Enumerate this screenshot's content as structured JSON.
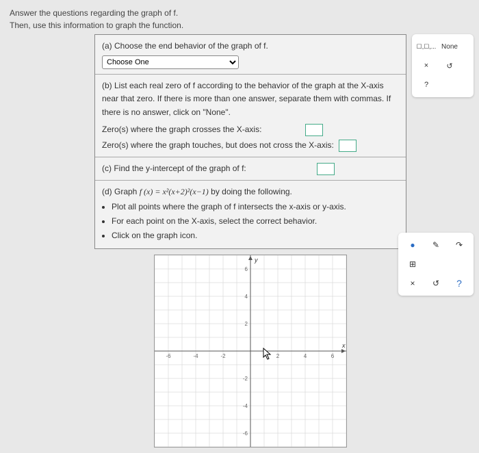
{
  "instructions": {
    "line1": "Answer the questions regarding the graph of f.",
    "line2": "Then, use this information to graph the function."
  },
  "partA": {
    "label": "(a) Choose the end behavior of the graph of f.",
    "select_placeholder": "Choose One"
  },
  "partB": {
    "label": "(b) List each real zero of f according to the behavior of the graph at the X-axis near that zero. If there is more than one answer, separate them with commas. If there is no answer, click on \"None\".",
    "row1": "Zero(s) where the graph crosses the X-axis:",
    "row2": "Zero(s) where the graph touches, but does not cross the X-axis:"
  },
  "partC": {
    "label": "(c) Find the y-intercept of the graph of f:"
  },
  "partD": {
    "label_prefix": "(d) Graph ",
    "formula": "f (x) = x²(x+2)²(x−1)",
    "label_suffix": " by doing the following.",
    "bul1": "Plot all points where the graph of f intersects the x-axis or y-axis.",
    "bul2": "For each point on the X-axis, select the correct behavior.",
    "bul3": "Click on the graph icon."
  },
  "toolbar1": {
    "btn1": "☐,☐,...",
    "btn2": "None",
    "btn3": "×",
    "btn4": "↺",
    "btn5": "?"
  },
  "toolbar2": {
    "btn1": "●",
    "btn2": "✎",
    "btn3": "↷",
    "btn4": "⊞",
    "btn5": "",
    "btn6": "",
    "btn7": "×",
    "btn8": "↺",
    "btn9": "?"
  },
  "chart_data": {
    "type": "scatter",
    "title": "",
    "xlabel": "x",
    "ylabel": "y",
    "xlim": [
      -7,
      7
    ],
    "ylim": [
      -7,
      7
    ],
    "xticks": [
      -6,
      -4,
      -2,
      2,
      4,
      6
    ],
    "yticks": [
      -6,
      -4,
      -2,
      2,
      4,
      6
    ],
    "series": []
  }
}
